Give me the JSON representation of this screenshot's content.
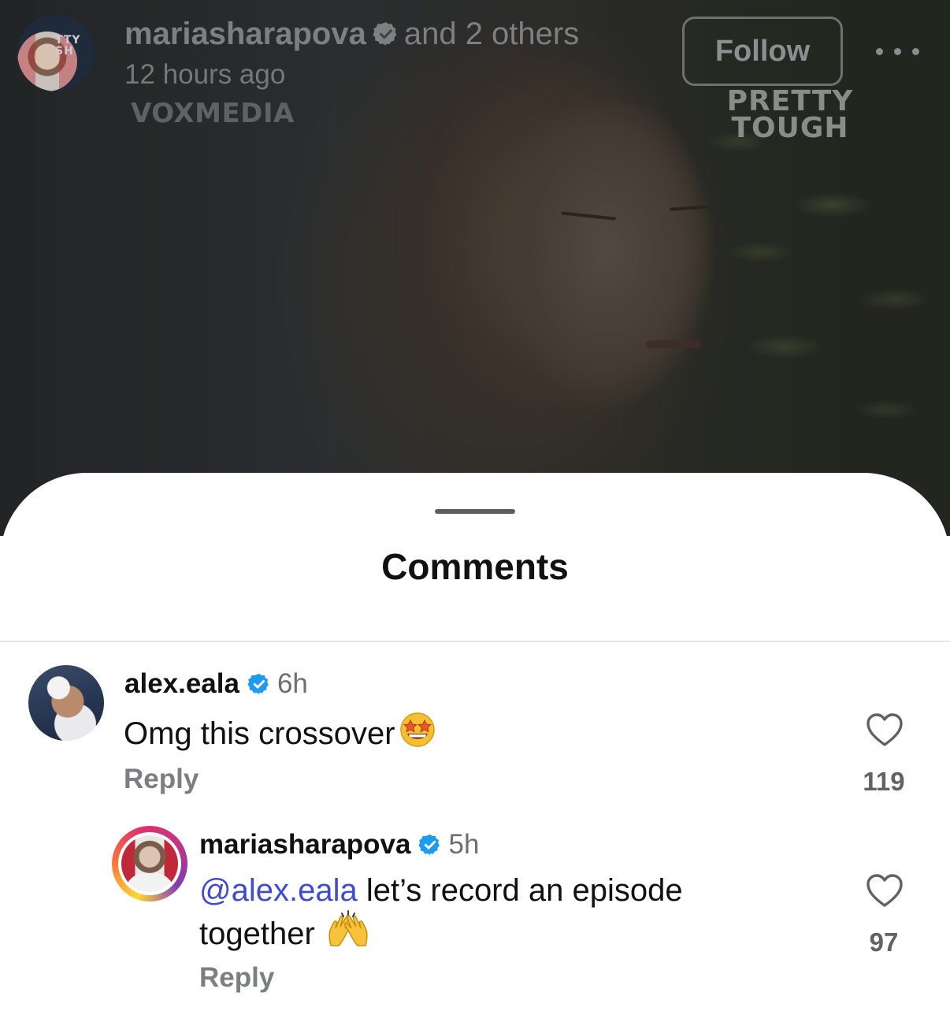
{
  "post_header": {
    "author": "mariasharapova",
    "others": "and 2 others",
    "time_ago": "12 hours ago",
    "watermark_left": "VOXMEDIA",
    "watermark_right": "PRETTY TOUGH",
    "avatar_badge": "TTY\nSH",
    "follow_label": "Follow",
    "more_icon": "more-horizontal-icon"
  },
  "sheet": {
    "title": "Comments"
  },
  "comments": [
    {
      "user": "alex.eala",
      "verified": true,
      "time": "6h",
      "text": "Omg this crossover",
      "emoji": "star-struck-emoji",
      "reply_label": "Reply",
      "likes": "119"
    },
    {
      "user": "mariasharapova",
      "verified": true,
      "time": "5h",
      "mention": "@alex.eala",
      "text_line1": " let’s record an episode",
      "text_line2": "together",
      "emoji": "raising-hands-emoji",
      "reply_label": "Reply",
      "likes": "97"
    }
  ],
  "colors": {
    "mention": "#3f4bd1",
    "verified": "#1d9bf0",
    "muted": "#7b7f82"
  }
}
